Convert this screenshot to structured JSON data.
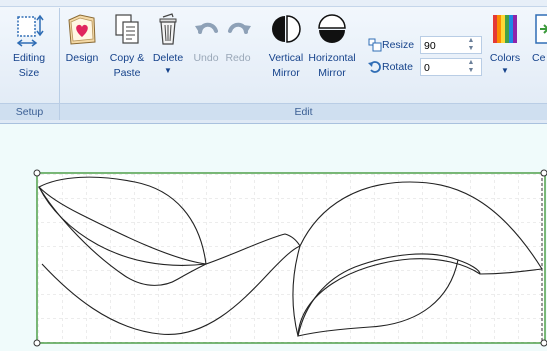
{
  "ribbon": {
    "setup": {
      "group_label": "Setup",
      "editing_size": {
        "line1": "Editing",
        "line2": "Size"
      }
    },
    "edit": {
      "group_label": "Edit",
      "design": {
        "line1": "Design"
      },
      "copy_paste": {
        "line1": "Copy &",
        "line2": "Paste"
      },
      "delete": {
        "line1": "Delete",
        "arrow": "▼"
      },
      "undo": {
        "line1": "Undo"
      },
      "redo": {
        "line1": "Redo"
      },
      "vertical_mirror": {
        "line1": "Vertical",
        "line2": "Mirror"
      },
      "horizontal_mirror": {
        "line1": "Horizontal",
        "line2": "Mirror"
      },
      "resize": {
        "label": "Resize",
        "value": "90"
      },
      "rotate": {
        "label": "Rotate",
        "value": "0"
      },
      "colors": {
        "line1": "Colors",
        "arrow": "▼"
      },
      "cutoff": {
        "line1": "Ce"
      }
    }
  },
  "icons": {
    "editing_size": "editing-size-icon",
    "design": "design-heart-icon",
    "copy_paste": "copy-paste-icon",
    "delete": "trash-icon",
    "undo": "undo-icon",
    "redo": "redo-icon",
    "vertical_mirror": "vertical-mirror-icon",
    "horizontal_mirror": "horizontal-mirror-icon",
    "resize": "resize-icon",
    "rotate": "rotate-icon",
    "colors": "color-palette-icon",
    "center": "center-icon"
  },
  "colors": {
    "ribbon_bg": "#dfe9f5",
    "selection_border": "#4fa04a",
    "canvas_bg": "#f0fbfb",
    "text": "#15428b"
  }
}
